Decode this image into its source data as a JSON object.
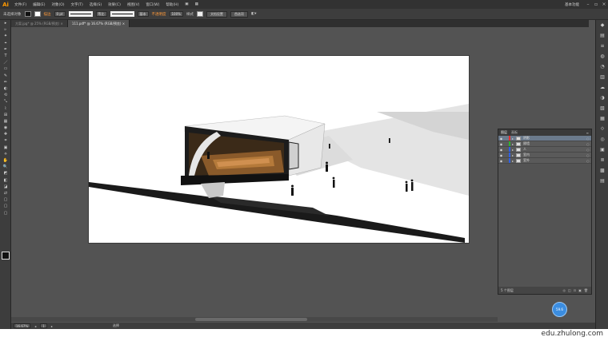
{
  "app": {
    "logo": "Ai",
    "window_title": "基本功能"
  },
  "menu": [
    "文件(F)",
    "编辑(E)",
    "对象(O)",
    "文字(T)",
    "选择(S)",
    "效果(C)",
    "视图(V)",
    "窗口(W)",
    "帮助(H)"
  ],
  "control": {
    "selection_label": "未选择对象",
    "stroke_label": "描边",
    "stroke_weight": "0 pt",
    "stroke_profile": "等比",
    "brush": "基本",
    "opacity_label": "不透明度",
    "opacity_value": "100%",
    "style_label": "样式",
    "doc_setup_button": "文档设置",
    "preferences_button": "首选项"
  },
  "tabs": [
    {
      "label": "方案.jpg* @ 25% (RGB/预览)",
      "active": false
    },
    {
      "label": "111.pdf* @ 16.67% (RGB/预览)",
      "active": true
    }
  ],
  "tools": [
    "▸",
    "▹",
    "✦",
    "⌖",
    "✒",
    "T",
    "／",
    "▭",
    "✎",
    "✏",
    "◐",
    "⟲",
    "⤡",
    "⌇",
    "⊞",
    "▦",
    "◉",
    "✚",
    "⌗",
    "▣",
    "⟡",
    "✋",
    "🔍",
    "◩",
    "◧",
    "◪",
    "⇄",
    "▢",
    "▢",
    "▢"
  ],
  "dock_icons": [
    "◆",
    "▤",
    "≡",
    "◍",
    "◔",
    "▥",
    "☁",
    "◑",
    "▧",
    "▦",
    "⟐",
    "◎",
    "▣",
    "≣",
    "▩",
    "▤"
  ],
  "layers_panel": {
    "tabs": [
      "图层",
      "画板"
    ],
    "rows": [
      {
        "name": "阴影",
        "color": "#e83030",
        "selected": true
      },
      {
        "name": "隔墙",
        "color": "#30b030",
        "selected": false
      },
      {
        "name": "人",
        "color": "#3060e0",
        "selected": false
      },
      {
        "name": "室内",
        "color": "#3060e0",
        "selected": false
      },
      {
        "name": "室外",
        "color": "#3060e0",
        "selected": false
      }
    ],
    "footer_count": "5 个图层"
  },
  "status": {
    "zoom": "16.67%",
    "page": "1",
    "tool_name": "选择"
  },
  "watermark": "edu.zhulong.com",
  "badge": "59.6"
}
